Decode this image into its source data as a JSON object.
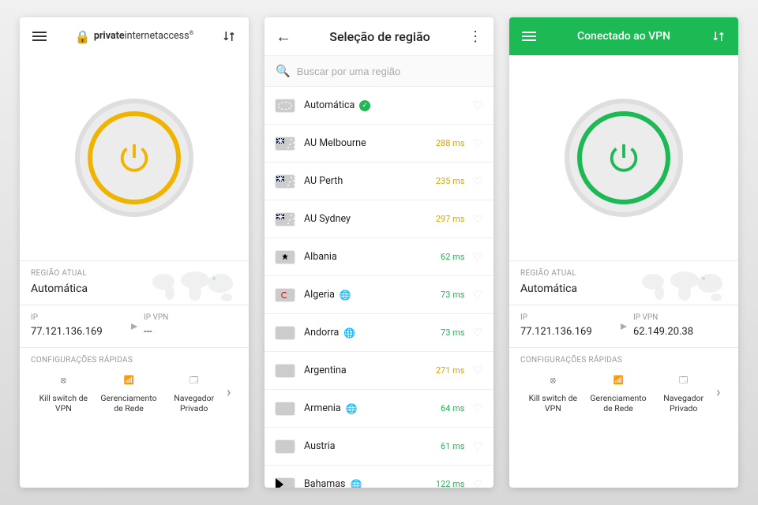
{
  "screen1": {
    "brand_1": "private",
    "brand_2": "internetaccess",
    "region_label": "REGIÃO ATUAL",
    "region_value": "Automática",
    "ip_label": "IP",
    "ip_value": "77.121.136.169",
    "ipvpn_label": "IP VPN",
    "ipvpn_value": "---",
    "quick_label": "CONFIGURAÇÕES RÁPIDAS",
    "quick1": "Kill switch de VPN",
    "quick2": "Gerenciamento de Rede",
    "quick3": "Navegador Privado"
  },
  "screen2": {
    "title": "Seleção de região",
    "search_placeholder": "Buscar por uma região",
    "rows": [
      {
        "name": "Automática",
        "ping": "",
        "ping_cls": "",
        "flag": "flag-auto",
        "check": true,
        "globe": false
      },
      {
        "name": "AU Melbourne",
        "ping": "288 ms",
        "ping_cls": "slow",
        "flag": "flag-au",
        "check": false,
        "globe": false
      },
      {
        "name": "AU Perth",
        "ping": "235 ms",
        "ping_cls": "slow",
        "flag": "flag-au",
        "check": false,
        "globe": false
      },
      {
        "name": "AU Sydney",
        "ping": "297 ms",
        "ping_cls": "slow",
        "flag": "flag-au",
        "check": false,
        "globe": false
      },
      {
        "name": "Albania",
        "ping": "62 ms",
        "ping_cls": "fast",
        "flag": "flag-al",
        "check": false,
        "globe": false
      },
      {
        "name": "Algeria",
        "ping": "73 ms",
        "ping_cls": "fast",
        "flag": "flag-dz",
        "check": false,
        "globe": true
      },
      {
        "name": "Andorra",
        "ping": "73 ms",
        "ping_cls": "fast",
        "flag": "flag-ad",
        "check": false,
        "globe": true
      },
      {
        "name": "Argentina",
        "ping": "271 ms",
        "ping_cls": "slow",
        "flag": "flag-ar",
        "check": false,
        "globe": false
      },
      {
        "name": "Armenia",
        "ping": "64 ms",
        "ping_cls": "fast",
        "flag": "flag-am",
        "check": false,
        "globe": true
      },
      {
        "name": "Austria",
        "ping": "61 ms",
        "ping_cls": "fast",
        "flag": "flag-at",
        "check": false,
        "globe": false
      },
      {
        "name": "Bahamas",
        "ping": "122 ms",
        "ping_cls": "fast",
        "flag": "flag-bs",
        "check": false,
        "globe": true
      }
    ]
  },
  "screen3": {
    "title": "Conectado ao VPN",
    "region_label": "REGIÃO ATUAL",
    "region_value": "Automática",
    "ip_label": "IP",
    "ip_value": "77.121.136.169",
    "ipvpn_label": "IP VPN",
    "ipvpn_value": "62.149.20.38",
    "quick_label": "CONFIGURAÇÕES RÁPIDAS",
    "quick1": "Kill switch de VPN",
    "quick2": "Gerenciamento de Rede",
    "quick3": "Navegador Privado"
  }
}
